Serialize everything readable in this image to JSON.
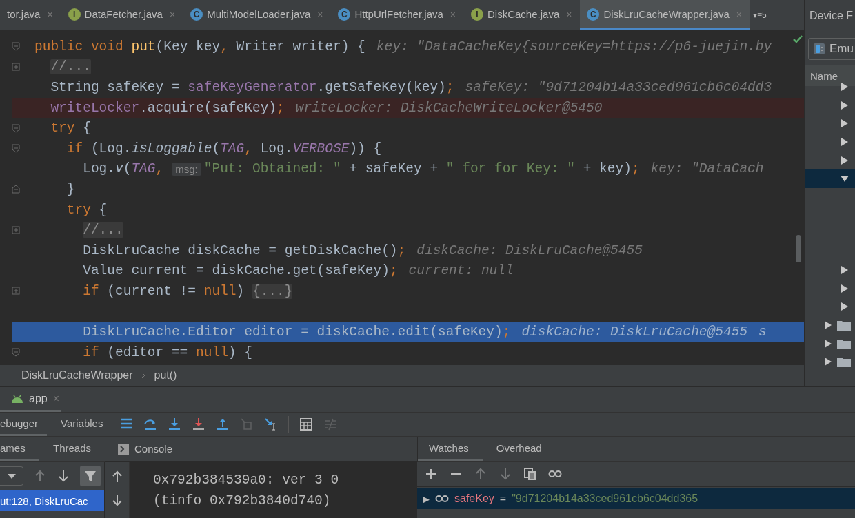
{
  "editor_tabs": [
    {
      "label": "tor.java",
      "close": "×",
      "selected": false
    },
    {
      "label": "DataFetcher.java",
      "icon": {
        "letter": "I",
        "kind": "interface"
      },
      "close": "×",
      "selected": false
    },
    {
      "label": "MultiModelLoader.java",
      "icon": {
        "letter": "C",
        "kind": "class"
      },
      "close": "×",
      "selected": false
    },
    {
      "label": "HttpUrlFetcher.java",
      "icon": {
        "letter": "C",
        "kind": "class"
      },
      "close": "×",
      "selected": false
    },
    {
      "label": "DiskCache.java",
      "icon": {
        "letter": "I",
        "kind": "interface"
      },
      "close": "×",
      "selected": false
    },
    {
      "label": "DiskLruCacheWrapper.java",
      "icon": {
        "letter": "C",
        "kind": "class"
      },
      "close": "×",
      "selected": true
    }
  ],
  "tab_overflow": "▾≡5",
  "code_lines": [
    {
      "kind": "code",
      "fold_marker": {
        "kind": "start"
      },
      "tokens": [
        {
          "kind": "kw",
          "text": "public void "
        },
        {
          "kind": "method",
          "text": "put"
        },
        {
          "kind": "plain",
          "text": "(Key key"
        },
        {
          "kind": "kw",
          "text": ","
        },
        {
          "kind": "plain",
          "text": " Writer writer) {"
        },
        {
          "kind": "hint",
          "text": "key: \"DataCacheKey{sourceKey=https://p6-juejin.by"
        }
      ],
      "children": [
        {
          "kind": "code",
          "fold_marker": {
            "kind": "collapsed"
          },
          "tokens": [
            {
              "kind": "fold",
              "text": "//..."
            }
          ]
        },
        {
          "kind": "code",
          "tokens": [
            {
              "kind": "plain",
              "text": "String safeKey = "
            },
            {
              "kind": "field",
              "text": "safeKeyGenerator"
            },
            {
              "kind": "plain",
              "text": ".getSafeKey(key)"
            },
            {
              "kind": "kw",
              "text": ";"
            },
            {
              "kind": "hint",
              "text": "safeKey: \"9d71204b14a33ced961cb6c04dd3"
            }
          ]
        },
        {
          "kind": "breakpoint",
          "tokens": [
            {
              "kind": "field",
              "text": "writeLocker"
            },
            {
              "kind": "plain",
              "text": ".acquire(safeKey)"
            },
            {
              "kind": "kw",
              "text": ";"
            },
            {
              "kind": "hint",
              "text": "writeLocker: DiskCacheWriteLocker@5450"
            }
          ]
        },
        {
          "kind": "code",
          "fold_marker": {
            "kind": "start"
          },
          "tokens": [
            {
              "kind": "kw",
              "text": "try"
            },
            {
              "kind": "plain",
              "text": " {"
            }
          ],
          "children": [
            {
              "kind": "code",
              "fold_marker": {
                "kind": "start"
              },
              "tokens": [
                {
                  "kind": "kw",
                  "text": "if"
                },
                {
                  "kind": "plain",
                  "text": " (Log."
                },
                {
                  "kind": "italic",
                  "text": "isLoggable"
                },
                {
                  "kind": "plain",
                  "text": "("
                },
                {
                  "kind": "static",
                  "text": "TAG"
                },
                {
                  "kind": "kw",
                  "text": ","
                },
                {
                  "kind": "plain",
                  "text": " Log."
                },
                {
                  "kind": "static",
                  "text": "VERBOSE"
                },
                {
                  "kind": "plain",
                  "text": ")) {"
                }
              ],
              "children": [
                {
                  "kind": "code",
                  "tokens": [
                    {
                      "kind": "plain",
                      "text": "Log."
                    },
                    {
                      "kind": "italic",
                      "text": "v"
                    },
                    {
                      "kind": "plain",
                      "text": "("
                    },
                    {
                      "kind": "static",
                      "text": "TAG"
                    },
                    {
                      "kind": "kw",
                      "text": ","
                    },
                    {
                      "kind": "param",
                      "text": "msg:"
                    },
                    {
                      "kind": "string",
                      "text": "\"Put: Obtained: \""
                    },
                    {
                      "kind": "plain",
                      "text": " + safeKey + "
                    },
                    {
                      "kind": "string",
                      "text": "\" for for Key: \""
                    },
                    {
                      "kind": "plain",
                      "text": " + key)"
                    },
                    {
                      "kind": "kw",
                      "text": ";"
                    },
                    {
                      "kind": "hint",
                      "text": "key: \"DataCach"
                    }
                  ]
                }
              ]
            },
            {
              "kind": "code",
              "fold_marker": {
                "kind": "end"
              },
              "tokens": [
                {
                  "kind": "plain",
                  "text": "}"
                }
              ]
            },
            {
              "kind": "code",
              "tokens": [
                {
                  "kind": "kw",
                  "text": "try"
                },
                {
                  "kind": "plain",
                  "text": " {"
                }
              ],
              "children": [
                {
                  "kind": "code",
                  "fold_marker": {
                    "kind": "collapsed"
                  },
                  "tokens": [
                    {
                      "kind": "fold",
                      "text": "//..."
                    }
                  ]
                },
                {
                  "kind": "code",
                  "tokens": [
                    {
                      "kind": "plain",
                      "text": "DiskLruCache diskCache = getDiskCache()"
                    },
                    {
                      "kind": "kw",
                      "text": ";"
                    },
                    {
                      "kind": "hint",
                      "text": "diskCache: DiskLruCache@5455"
                    }
                  ]
                },
                {
                  "kind": "code",
                  "tokens": [
                    {
                      "kind": "plain",
                      "text": "Value current = diskCache.get(safeKey)"
                    },
                    {
                      "kind": "kw",
                      "text": ";"
                    },
                    {
                      "kind": "hint",
                      "text": "current: null"
                    }
                  ]
                },
                {
                  "kind": "code",
                  "fold_marker": {
                    "kind": "collapsed"
                  },
                  "tokens": [
                    {
                      "kind": "kw",
                      "text": "if"
                    },
                    {
                      "kind": "plain",
                      "text": " (current != "
                    },
                    {
                      "kind": "kw",
                      "text": "null"
                    },
                    {
                      "kind": "plain",
                      "text": ") "
                    },
                    {
                      "kind": "fold",
                      "text": "{...}"
                    }
                  ]
                },
                {
                  "kind": "code"
                },
                {
                  "kind": "execution",
                  "tokens": [
                    {
                      "kind": "plain",
                      "text": "DiskLruCache.Editor editor = diskCache.edit(safeKey)"
                    },
                    {
                      "kind": "kw",
                      "text": ";"
                    },
                    {
                      "kind": "hint",
                      "text": "diskCache: DiskLruCache@5455"
                    },
                    {
                      "kind": "hint",
                      "text": "s"
                    }
                  ]
                },
                {
                  "kind": "code",
                  "fold_marker": {
                    "kind": "start"
                  },
                  "tokens": [
                    {
                      "kind": "kw",
                      "text": "if"
                    },
                    {
                      "kind": "plain",
                      "text": " (editor == "
                    },
                    {
                      "kind": "kw",
                      "text": "null"
                    },
                    {
                      "kind": "plain",
                      "text": ") {"
                    }
                  ]
                }
              ]
            }
          ]
        }
      ]
    }
  ],
  "breadcrumb": [
    "DiskLruCacheWrapper",
    "put()"
  ],
  "device_panel": {
    "title": "Device F",
    "device": "Emu",
    "column": "Name",
    "tree": [
      {
        "kind": "node",
        "expanded": false,
        "selected": false
      },
      {
        "kind": "node",
        "expanded": false,
        "selected": false
      },
      {
        "kind": "node",
        "expanded": false,
        "selected": false
      },
      {
        "kind": "node",
        "expanded": false,
        "selected": false
      },
      {
        "kind": "node",
        "expanded": false,
        "selected": false
      },
      {
        "kind": "node",
        "expanded": true,
        "selected": true
      },
      {
        "kind": "node",
        "expanded": false,
        "selected": false
      },
      {
        "kind": "node",
        "expanded": false,
        "selected": false
      },
      {
        "kind": "node",
        "expanded": false,
        "selected": false
      },
      {
        "kind": "folder",
        "expanded": false,
        "selected": false
      },
      {
        "kind": "folder",
        "expanded": false,
        "selected": false
      },
      {
        "kind": "folder",
        "expanded": false,
        "selected": false
      }
    ]
  },
  "run_tab": {
    "label": "app",
    "close": "×"
  },
  "debug_tabs": [
    {
      "label": "ebugger",
      "selected": true
    },
    {
      "label": "Variables",
      "selected": false
    }
  ],
  "debug_toolbar": [
    {
      "kind": "frames",
      "disabled": false
    },
    {
      "kind": "step-over",
      "disabled": false
    },
    {
      "kind": "step-into",
      "disabled": false
    },
    {
      "kind": "force-step-into",
      "disabled": false
    },
    {
      "kind": "step-out",
      "disabled": false
    },
    {
      "kind": "drop-frame",
      "disabled": true
    },
    {
      "kind": "run-to-cursor",
      "disabled": false
    },
    {
      "kind": "separator"
    },
    {
      "kind": "evaluate",
      "disabled": false
    },
    {
      "kind": "trace",
      "disabled": true
    }
  ],
  "frames_tabs": [
    {
      "label": "ames",
      "selected": true
    },
    {
      "label": "Threads",
      "selected": false
    }
  ],
  "frames_toolbar": [
    {
      "kind": "dropdown"
    },
    {
      "kind": "up",
      "disabled": true
    },
    {
      "kind": "down",
      "disabled": false
    },
    {
      "kind": "filter",
      "disabled": false
    }
  ],
  "frames": [
    {
      "text": "ut:128, DiskLruCac",
      "selected": true
    }
  ],
  "console": {
    "tab": "Console",
    "lines": [
      "0x792b384539a0: ver 3 0",
      "(tinfo 0x792b3840d740)"
    ]
  },
  "watches_tabs": [
    {
      "label": "Watches",
      "selected": true
    },
    {
      "label": "Overhead",
      "selected": false
    }
  ],
  "watches_toolbar": [
    {
      "kind": "add",
      "disabled": false
    },
    {
      "kind": "remove",
      "disabled": false
    },
    {
      "kind": "up",
      "disabled": true
    },
    {
      "kind": "down",
      "disabled": true
    },
    {
      "kind": "copy",
      "disabled": false
    },
    {
      "kind": "glasses",
      "disabled": false
    }
  ],
  "watches": [
    {
      "expander": "▶",
      "name": "safeKey",
      "equals": "=",
      "value": "\"9d71204b14a33ced961cb6c04dd365",
      "selected": true
    }
  ]
}
